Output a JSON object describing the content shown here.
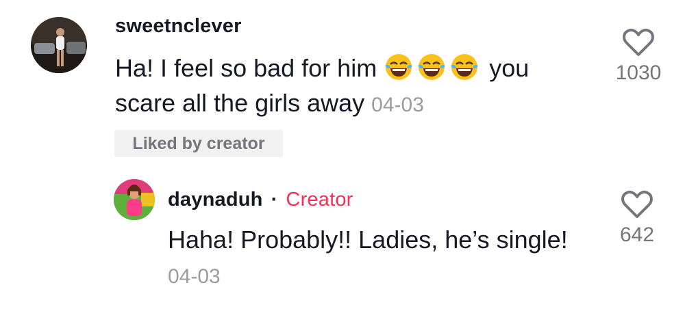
{
  "comment": {
    "username": "sweetnclever",
    "text_before": "Ha! I feel so bad for him",
    "emoji": [
      "face-with-tears-of-joy",
      "face-with-tears-of-joy",
      "face-with-tears-of-joy"
    ],
    "text_after": "you scare all the girls away",
    "date": "04-03",
    "badge": "Liked by creator",
    "like_count": "1030",
    "like_icon": "heart-outline-icon"
  },
  "reply": {
    "username": "daynaduh",
    "separator": "·",
    "role_tag": "Creator",
    "text": "Haha! Probably!! Ladies, he’s single!",
    "date": "04-03",
    "like_count": "642",
    "like_icon": "heart-outline-icon"
  },
  "colors": {
    "text": "#161823",
    "secondary": "#75757c",
    "date": "#9b9ba1",
    "creator_accent": "#fe2c55",
    "badge_bg": "#f1f1f2"
  }
}
